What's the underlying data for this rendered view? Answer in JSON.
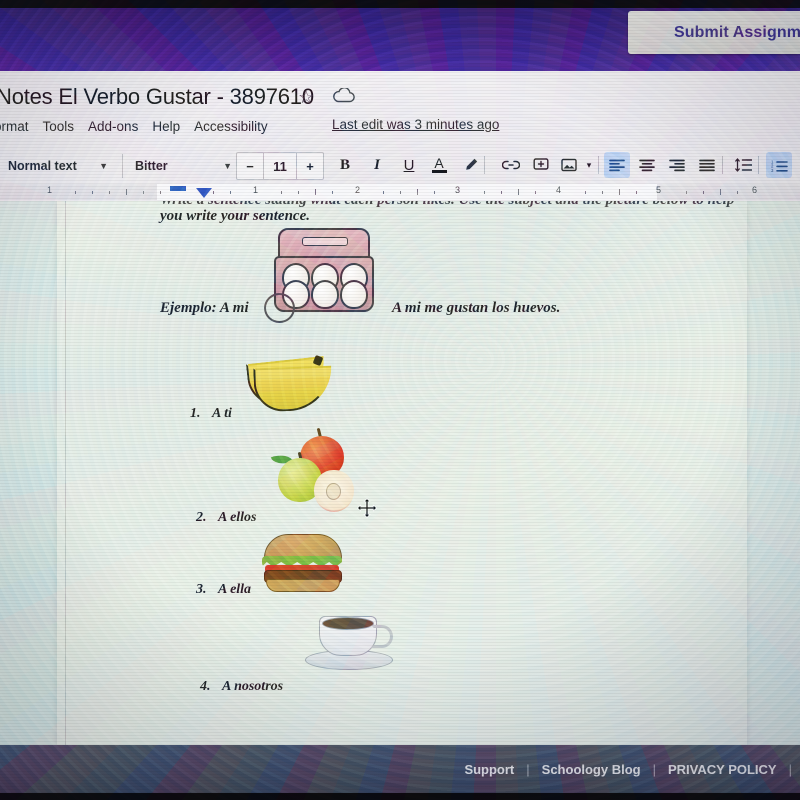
{
  "lms_bar": {
    "submit_label": "Submit Assignment",
    "bar_color": "#351c78"
  },
  "docs": {
    "title": "Notes El Verbo Gustar - 3897610",
    "star_icon": "star-icon",
    "cloud_icon": "cloud-saved-icon",
    "menus": [
      "ormat",
      "Tools",
      "Add-ons",
      "Help",
      "Accessibility"
    ],
    "last_edit": "Last edit was 3 minutes ago",
    "toolbar": {
      "paragraph_style": "Normal text",
      "font": "Bitter",
      "font_size_minus": "−",
      "font_size": "11",
      "font_size_plus": "+",
      "bold": "B",
      "italic": "I",
      "underline": "U",
      "text_color": "A",
      "highlight": "highlight-pen-icon",
      "link": "link-icon",
      "comment": "add-comment-icon",
      "image": "insert-image-icon",
      "image_caret": "▾",
      "align_left": "align-left-icon",
      "align_center": "align-center-icon",
      "align_right": "align-right-icon",
      "align_justify": "align-justify-icon",
      "line_spacing": "line-spacing-icon",
      "numbered_list": "numbered-list-icon"
    },
    "ruler": {
      "marks": [
        "1",
        "1",
        "2",
        "3",
        "4",
        "5",
        "6"
      ]
    }
  },
  "document": {
    "intro_line1": "Write a sentence stating what each person likes. Use the subject and the picture below to help",
    "intro_line2": "you write your sentence.",
    "example_prompt": "Ejemplo: A mi",
    "example_answer": "A mi me gustan los huevos.",
    "items": [
      {
        "num": "1.",
        "text": "A ti",
        "image": "bananas-clipart"
      },
      {
        "num": "2.",
        "text": "A ellos",
        "image": "apples-clipart"
      },
      {
        "num": "3.",
        "text": "A ella",
        "image": "hamburger-clipart"
      },
      {
        "num": "4.",
        "text": "A nosotros",
        "image": "coffee-cup-clipart"
      }
    ],
    "example_image": "egg-carton-clipart"
  },
  "cursor": {
    "type": "move-cursor"
  },
  "footer": {
    "links": [
      "Support",
      "Schoology Blog",
      "PRIVACY POLICY"
    ],
    "separator": "|"
  }
}
